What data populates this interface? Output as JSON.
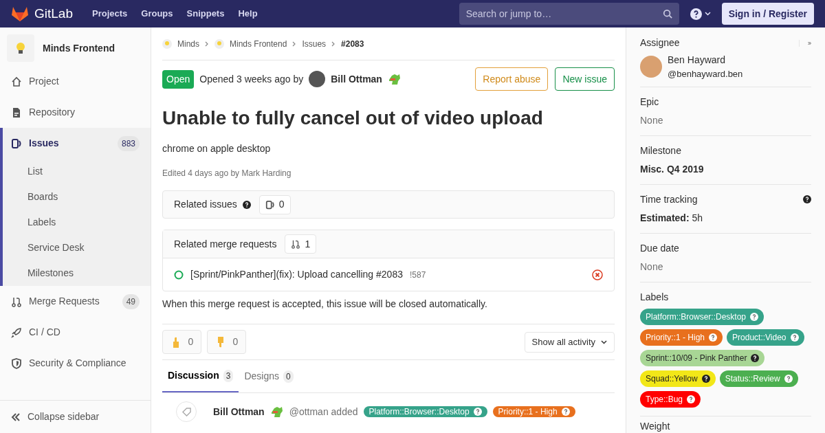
{
  "header": {
    "brand": "GitLab",
    "nav": [
      "Projects",
      "Groups",
      "Snippets",
      "Help"
    ],
    "search": {
      "placeholder": "Search or jump to…"
    },
    "sign_in": "Sign in / Register"
  },
  "sidebar": {
    "project": "Minds Frontend",
    "items": [
      {
        "kind": "home",
        "label": "Project",
        "selected": false
      },
      {
        "kind": "repo",
        "label": "Repository",
        "selected": false
      },
      {
        "kind": "issues",
        "label": "Issues",
        "count": "883",
        "selected": true,
        "children": [
          {
            "label": "List"
          },
          {
            "label": "Boards"
          },
          {
            "label": "Labels"
          },
          {
            "label": "Service Desk"
          },
          {
            "label": "Milestones"
          }
        ]
      },
      {
        "kind": "merge",
        "label": "Merge Requests",
        "count": "49",
        "selected": false
      },
      {
        "kind": "rocket",
        "label": "CI / CD",
        "selected": false
      },
      {
        "kind": "shield",
        "label": "Security & Compliance",
        "selected": false
      }
    ],
    "collapse": "Collapse sidebar"
  },
  "breadcrumbs": [
    {
      "label": "Minds",
      "avatar": true
    },
    {
      "label": "Minds Frontend",
      "avatar": true
    },
    {
      "label": "Issues",
      "avatar": false
    },
    {
      "label": "#2083",
      "avatar": false
    }
  ],
  "issue": {
    "status": "Open",
    "opened": "Opened 3 weeks ago by",
    "author": "Bill Ottman",
    "actions": [
      {
        "label": "Report abuse",
        "kind": "warning"
      },
      {
        "label": "New issue",
        "kind": "success"
      }
    ],
    "title": "Unable to fully cancel out of video upload",
    "description": "chrome on apple desktop",
    "edited": "Edited 4 days ago by Mark Harding"
  },
  "related_issues": {
    "title": "Related issues",
    "count": "0"
  },
  "related_merge_requests": {
    "title": "Related merge requests",
    "count": "1",
    "items": [
      {
        "title": "[Sprint/PinkPanther](fix): Upload cancelling #2083",
        "ref": "!587"
      }
    ]
  },
  "merge_note": "When this merge request is accepted, this issue will be closed automatically.",
  "awards": [
    {
      "kind": "thumbsup",
      "count": "0"
    },
    {
      "kind": "thumbsdown",
      "count": "0"
    }
  ],
  "activity_filter": "Show all activity",
  "tabs": [
    {
      "label": "Discussion",
      "count": "3",
      "selected": true
    },
    {
      "label": "Designs",
      "count": "0",
      "selected": false
    }
  ],
  "timeline": [
    {
      "author": "Bill Ottman",
      "action": "@ottman added",
      "labels": [
        {
          "text": "Platform::Browser::Desktop",
          "color": "#36a38a"
        },
        {
          "text": "Priority::1 - High",
          "color": "#e8701e"
        }
      ]
    }
  ],
  "right_sidebar": {
    "assignee": {
      "heading": "Assignee",
      "name": "Ben Hayward",
      "username": "@benhayward.ben"
    },
    "epic": {
      "heading": "Epic",
      "value": "None"
    },
    "milestone": {
      "heading": "Milestone",
      "value": "Misc. Q4 2019"
    },
    "time_tracking": {
      "heading": "Time tracking",
      "value": "**Estimated:** 5h"
    },
    "due_date": {
      "heading": "Due date",
      "value": "None"
    },
    "labels": {
      "heading": "Labels",
      "items": [
        {
          "text": "Platform::Browser::Desktop",
          "color": "#36a38a",
          "dark_text": false
        },
        {
          "text": "Priority::1 - High",
          "color": "#e8701e",
          "dark_text": false
        },
        {
          "text": "Product::Video",
          "color": "#36a38a",
          "dark_text": false
        },
        {
          "text": "Sprint::10/09 - Pink Panther",
          "color": "#a8d695",
          "dark_text": true
        },
        {
          "text": "Squad::Yellow",
          "color": "#f2e718",
          "dark_text": true
        },
        {
          "text": "Status::Review",
          "color": "#4caf50",
          "dark_text": false
        },
        {
          "text": "Type::Bug",
          "color": "#ff0000",
          "dark_text": false
        }
      ]
    },
    "weight": {
      "heading": "Weight"
    }
  }
}
